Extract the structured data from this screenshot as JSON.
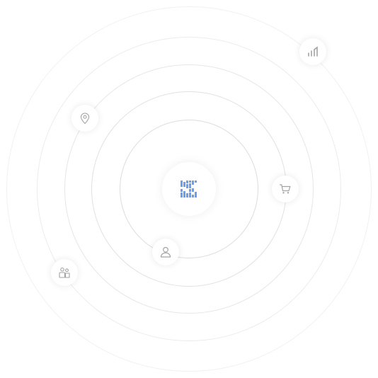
{
  "center": {
    "logo_icon": "pixel-logo-icon",
    "accent_color": "#6a9ef0"
  },
  "orbit_icons": [
    {
      "name": "signal-bars-icon"
    },
    {
      "name": "location-pin-icon"
    },
    {
      "name": "shopping-cart-icon"
    },
    {
      "name": "user-icon"
    },
    {
      "name": "user-group-icon"
    }
  ],
  "colors": {
    "ring": "#e3e3e3",
    "icon": "#a3a3a3",
    "background": "#ffffff"
  }
}
